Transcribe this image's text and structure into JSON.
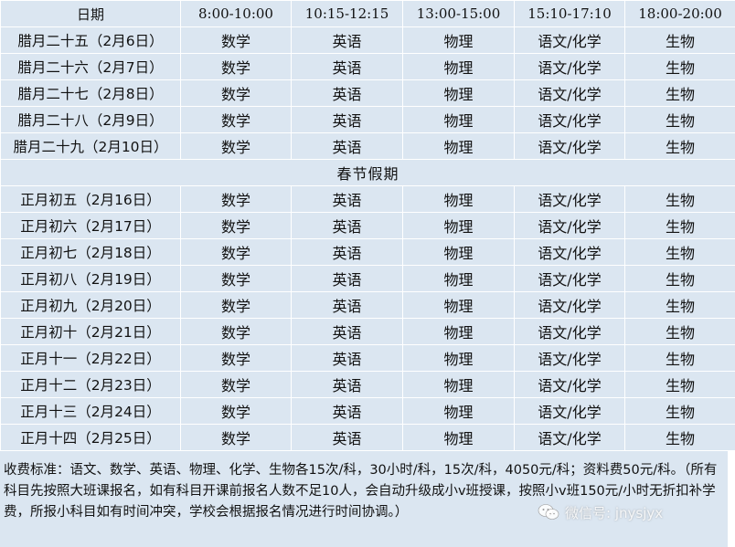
{
  "table": {
    "headers": [
      "日期",
      "8:00-10:00",
      "10:15-12:15",
      "13:00-15:00",
      "15:10-17:10",
      "18:00-20:00"
    ],
    "rows_before": [
      {
        "date": "腊月二十五（2月6日）",
        "cells": [
          "数学",
          "英语",
          "物理",
          "语文/化学",
          "生物"
        ]
      },
      {
        "date": "腊月二十六（2月7日）",
        "cells": [
          "数学",
          "英语",
          "物理",
          "语文/化学",
          "生物"
        ]
      },
      {
        "date": "腊月二十七（2月8日）",
        "cells": [
          "数学",
          "英语",
          "物理",
          "语文/化学",
          "生物"
        ]
      },
      {
        "date": "腊月二十八（2月9日）",
        "cells": [
          "数学",
          "英语",
          "物理",
          "语文/化学",
          "生物"
        ]
      },
      {
        "date": "腊月二十九（2月10日）",
        "cells": [
          "数学",
          "英语",
          "物理",
          "语文/化学",
          "生物"
        ]
      }
    ],
    "break_label": "春节假期",
    "rows_after": [
      {
        "date": "正月初五（2月16日）",
        "cells": [
          "数学",
          "英语",
          "物理",
          "语文/化学",
          "生物"
        ]
      },
      {
        "date": "正月初六（2月17日）",
        "cells": [
          "数学",
          "英语",
          "物理",
          "语文/化学",
          "生物"
        ]
      },
      {
        "date": "正月初七（2月18日）",
        "cells": [
          "数学",
          "英语",
          "物理",
          "语文/化学",
          "生物"
        ]
      },
      {
        "date": "正月初八（2月19日）",
        "cells": [
          "数学",
          "英语",
          "物理",
          "语文/化学",
          "生物"
        ]
      },
      {
        "date": "正月初九（2月20日）",
        "cells": [
          "数学",
          "英语",
          "物理",
          "语文/化学",
          "生物"
        ]
      },
      {
        "date": "正月初十（2月21日）",
        "cells": [
          "数学",
          "英语",
          "物理",
          "语文/化学",
          "生物"
        ]
      },
      {
        "date": "正月十一（2月22日）",
        "cells": [
          "数学",
          "英语",
          "物理",
          "语文/化学",
          "生物"
        ]
      },
      {
        "date": "正月十二（2月23日）",
        "cells": [
          "数学",
          "英语",
          "物理",
          "语文/化学",
          "生物"
        ]
      },
      {
        "date": "正月十三（2月24日）",
        "cells": [
          "数学",
          "英语",
          "物理",
          "语文/化学",
          "生物"
        ]
      },
      {
        "date": "正月十四（2月25日）",
        "cells": [
          "数学",
          "英语",
          "物理",
          "语文/化学",
          "生物"
        ]
      }
    ]
  },
  "note": "收费标准：语文、数学、英语、物理、化学、生物各15次/科，30小时/科，15次/科，4050元/科；资料费50元/科。（所有科目先按照大班课报名，如有科目开课前报名人数不足10人，会自动升级成小v班授课，按照小v班150元/小时无折扣补学费，所报小科目如有时间冲突，学校会根据报名情况进行时间协调。）",
  "watermark": {
    "text": "微信号: jnysjyx",
    "icon": "wechat-icon"
  },
  "colors": {
    "cell_bg": "#dbe6f1",
    "grid": "#ffffff",
    "text": "#111111"
  }
}
